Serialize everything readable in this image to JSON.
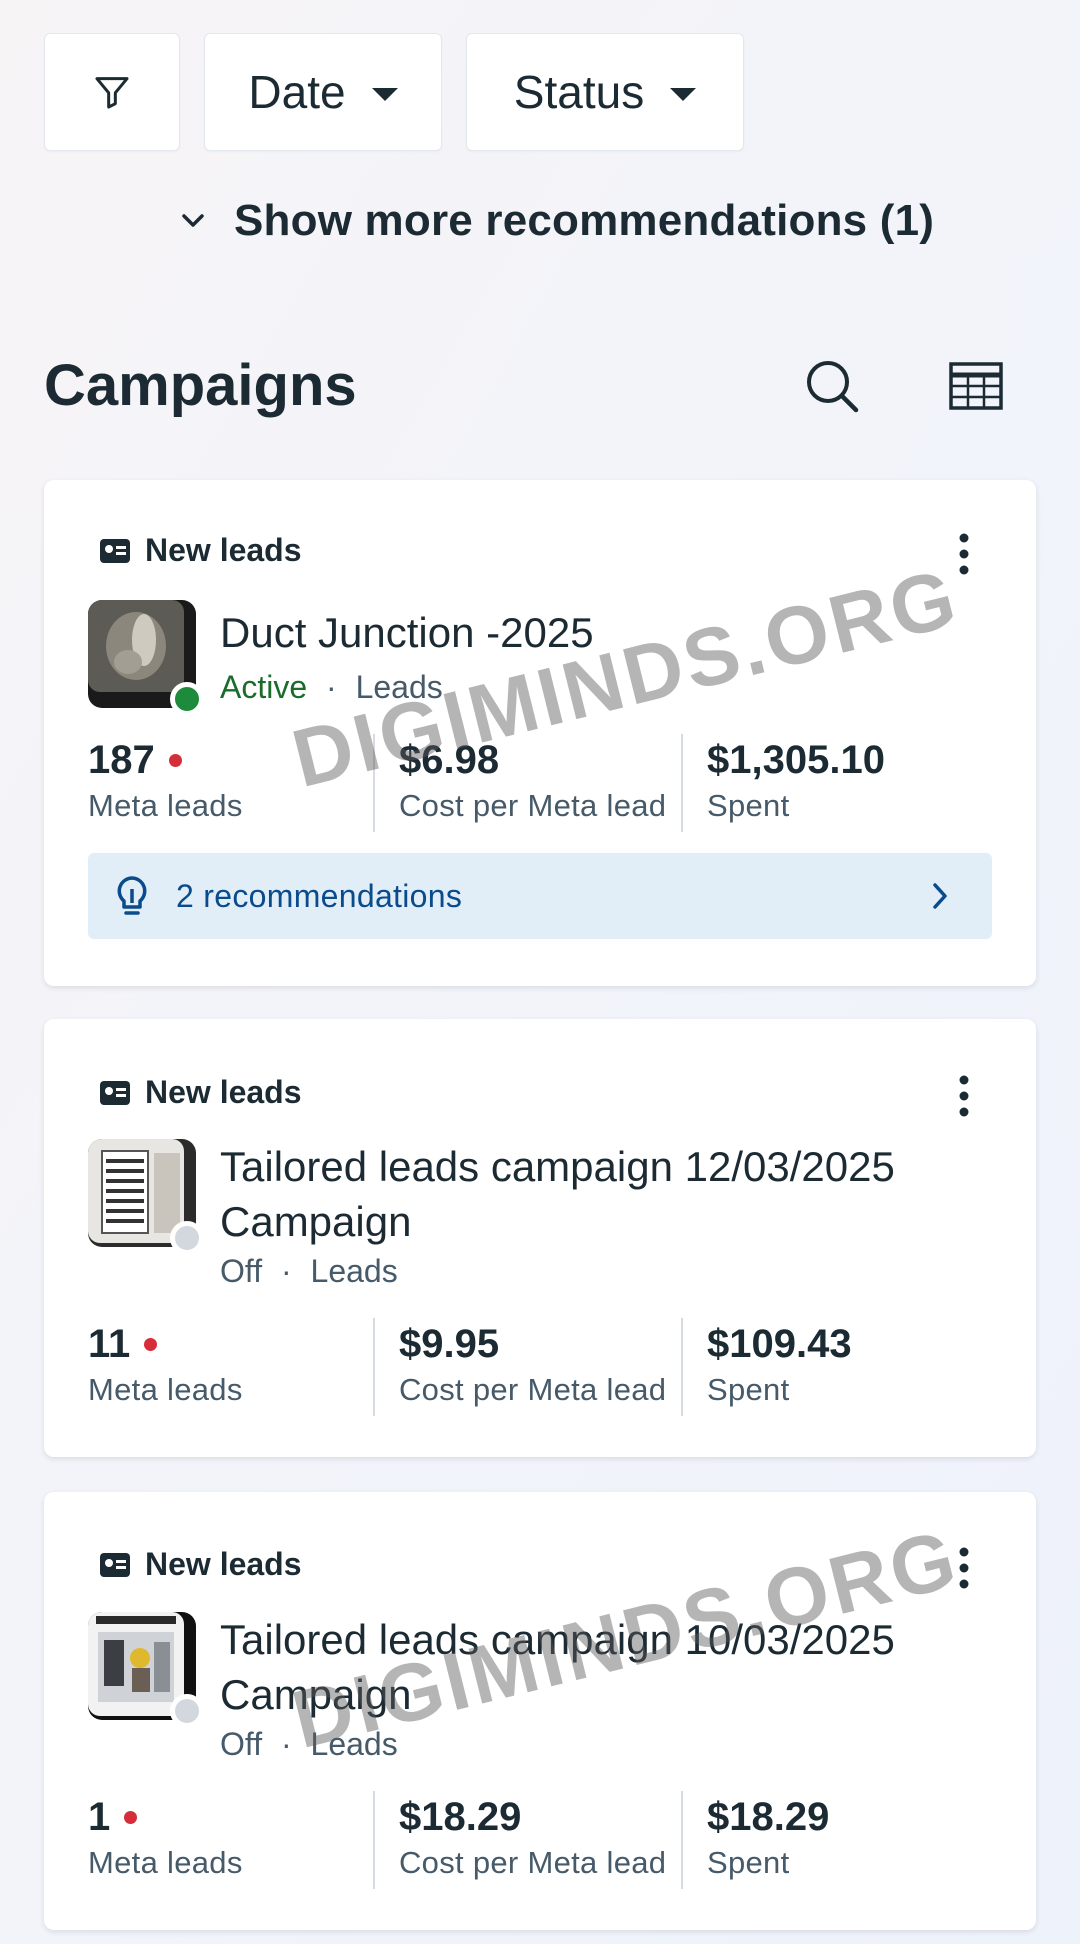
{
  "filters": {
    "filter_icon": "filter-icon",
    "date_label": "Date",
    "status_label": "Status"
  },
  "recommendations_toggle": {
    "label": "Show more recommendations (1)"
  },
  "section": {
    "title": "Campaigns",
    "icons": [
      "search-icon",
      "table-icon"
    ]
  },
  "campaigns": [
    {
      "tag": "New leads",
      "name": "Duct Junction -2025",
      "status": "Active",
      "separator": "·",
      "objective": "Leads",
      "status_color": "#1e8a3c",
      "metrics": [
        {
          "value": "187",
          "label": "Meta leads"
        },
        {
          "value": "$6.98",
          "label": "Cost per Meta lead"
        },
        {
          "value": "$1,305.10",
          "label": "Spent"
        }
      ],
      "recommendations": "2 recommendations"
    },
    {
      "tag": "New leads",
      "name_line1": "Tailored leads campaign 12/03/2025",
      "name_line2": "Campaign",
      "status": "Off",
      "separator": "·",
      "objective": "Leads",
      "status_color": "#d3d8de",
      "metrics": [
        {
          "value": "11",
          "label": "Meta leads"
        },
        {
          "value": "$9.95",
          "label": "Cost per Meta lead"
        },
        {
          "value": "$109.43",
          "label": "Spent"
        }
      ]
    },
    {
      "tag": "New leads",
      "name_line1": "Tailored leads campaign 10/03/2025",
      "name_line2": "Campaign",
      "status": "Off",
      "separator": "·",
      "objective": "Leads",
      "status_color": "#d3d8de",
      "metrics": [
        {
          "value": "1",
          "label": "Meta leads"
        },
        {
          "value": "$18.29",
          "label": "Cost per Meta lead"
        },
        {
          "value": "$18.29",
          "label": "Spent"
        }
      ]
    }
  ],
  "watermark": "DIGIMINDS.ORG",
  "colors": {
    "accent_blue": "#0a4b8c",
    "recommendation_bg": "#e1edf7",
    "lead_dot": "#d62d3a"
  }
}
